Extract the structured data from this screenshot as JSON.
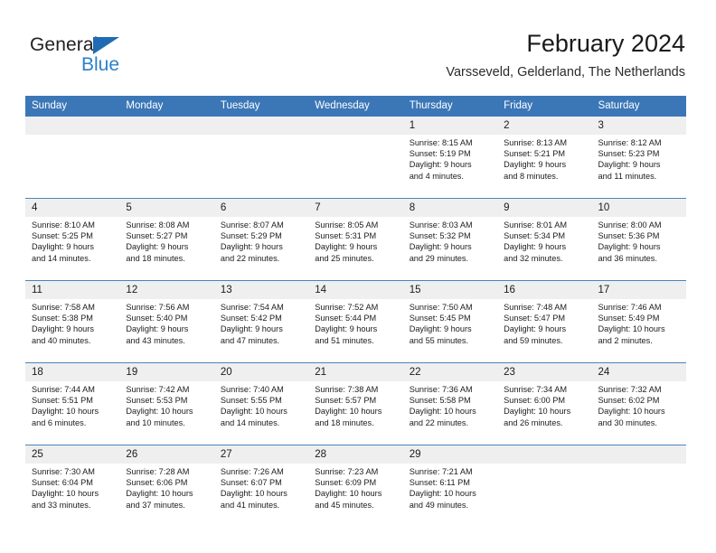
{
  "brand": {
    "name_part1": "General",
    "name_part2": "Blue",
    "triangle_color": "#1f6cb4",
    "blue_color": "#2a81c8"
  },
  "header": {
    "title": "February 2024",
    "subtitle": "Varsseveld, Gelderland, The Netherlands"
  },
  "theme": {
    "header_blue": "#3b77b7",
    "row_divider": "#4a84be",
    "daynum_band": "#efefef"
  },
  "weekday_headers": [
    "Sunday",
    "Monday",
    "Tuesday",
    "Wednesday",
    "Thursday",
    "Friday",
    "Saturday"
  ],
  "weeks": [
    [
      {
        "day": "",
        "lines": []
      },
      {
        "day": "",
        "lines": []
      },
      {
        "day": "",
        "lines": []
      },
      {
        "day": "",
        "lines": []
      },
      {
        "day": "1",
        "lines": [
          "Sunrise: 8:15 AM",
          "Sunset: 5:19 PM",
          "Daylight: 9 hours",
          "and 4 minutes."
        ]
      },
      {
        "day": "2",
        "lines": [
          "Sunrise: 8:13 AM",
          "Sunset: 5:21 PM",
          "Daylight: 9 hours",
          "and 8 minutes."
        ]
      },
      {
        "day": "3",
        "lines": [
          "Sunrise: 8:12 AM",
          "Sunset: 5:23 PM",
          "Daylight: 9 hours",
          "and 11 minutes."
        ]
      }
    ],
    [
      {
        "day": "4",
        "lines": [
          "Sunrise: 8:10 AM",
          "Sunset: 5:25 PM",
          "Daylight: 9 hours",
          "and 14 minutes."
        ]
      },
      {
        "day": "5",
        "lines": [
          "Sunrise: 8:08 AM",
          "Sunset: 5:27 PM",
          "Daylight: 9 hours",
          "and 18 minutes."
        ]
      },
      {
        "day": "6",
        "lines": [
          "Sunrise: 8:07 AM",
          "Sunset: 5:29 PM",
          "Daylight: 9 hours",
          "and 22 minutes."
        ]
      },
      {
        "day": "7",
        "lines": [
          "Sunrise: 8:05 AM",
          "Sunset: 5:31 PM",
          "Daylight: 9 hours",
          "and 25 minutes."
        ]
      },
      {
        "day": "8",
        "lines": [
          "Sunrise: 8:03 AM",
          "Sunset: 5:32 PM",
          "Daylight: 9 hours",
          "and 29 minutes."
        ]
      },
      {
        "day": "9",
        "lines": [
          "Sunrise: 8:01 AM",
          "Sunset: 5:34 PM",
          "Daylight: 9 hours",
          "and 32 minutes."
        ]
      },
      {
        "day": "10",
        "lines": [
          "Sunrise: 8:00 AM",
          "Sunset: 5:36 PM",
          "Daylight: 9 hours",
          "and 36 minutes."
        ]
      }
    ],
    [
      {
        "day": "11",
        "lines": [
          "Sunrise: 7:58 AM",
          "Sunset: 5:38 PM",
          "Daylight: 9 hours",
          "and 40 minutes."
        ]
      },
      {
        "day": "12",
        "lines": [
          "Sunrise: 7:56 AM",
          "Sunset: 5:40 PM",
          "Daylight: 9 hours",
          "and 43 minutes."
        ]
      },
      {
        "day": "13",
        "lines": [
          "Sunrise: 7:54 AM",
          "Sunset: 5:42 PM",
          "Daylight: 9 hours",
          "and 47 minutes."
        ]
      },
      {
        "day": "14",
        "lines": [
          "Sunrise: 7:52 AM",
          "Sunset: 5:44 PM",
          "Daylight: 9 hours",
          "and 51 minutes."
        ]
      },
      {
        "day": "15",
        "lines": [
          "Sunrise: 7:50 AM",
          "Sunset: 5:45 PM",
          "Daylight: 9 hours",
          "and 55 minutes."
        ]
      },
      {
        "day": "16",
        "lines": [
          "Sunrise: 7:48 AM",
          "Sunset: 5:47 PM",
          "Daylight: 9 hours",
          "and 59 minutes."
        ]
      },
      {
        "day": "17",
        "lines": [
          "Sunrise: 7:46 AM",
          "Sunset: 5:49 PM",
          "Daylight: 10 hours",
          "and 2 minutes."
        ]
      }
    ],
    [
      {
        "day": "18",
        "lines": [
          "Sunrise: 7:44 AM",
          "Sunset: 5:51 PM",
          "Daylight: 10 hours",
          "and 6 minutes."
        ]
      },
      {
        "day": "19",
        "lines": [
          "Sunrise: 7:42 AM",
          "Sunset: 5:53 PM",
          "Daylight: 10 hours",
          "and 10 minutes."
        ]
      },
      {
        "day": "20",
        "lines": [
          "Sunrise: 7:40 AM",
          "Sunset: 5:55 PM",
          "Daylight: 10 hours",
          "and 14 minutes."
        ]
      },
      {
        "day": "21",
        "lines": [
          "Sunrise: 7:38 AM",
          "Sunset: 5:57 PM",
          "Daylight: 10 hours",
          "and 18 minutes."
        ]
      },
      {
        "day": "22",
        "lines": [
          "Sunrise: 7:36 AM",
          "Sunset: 5:58 PM",
          "Daylight: 10 hours",
          "and 22 minutes."
        ]
      },
      {
        "day": "23",
        "lines": [
          "Sunrise: 7:34 AM",
          "Sunset: 6:00 PM",
          "Daylight: 10 hours",
          "and 26 minutes."
        ]
      },
      {
        "day": "24",
        "lines": [
          "Sunrise: 7:32 AM",
          "Sunset: 6:02 PM",
          "Daylight: 10 hours",
          "and 30 minutes."
        ]
      }
    ],
    [
      {
        "day": "25",
        "lines": [
          "Sunrise: 7:30 AM",
          "Sunset: 6:04 PM",
          "Daylight: 10 hours",
          "and 33 minutes."
        ]
      },
      {
        "day": "26",
        "lines": [
          "Sunrise: 7:28 AM",
          "Sunset: 6:06 PM",
          "Daylight: 10 hours",
          "and 37 minutes."
        ]
      },
      {
        "day": "27",
        "lines": [
          "Sunrise: 7:26 AM",
          "Sunset: 6:07 PM",
          "Daylight: 10 hours",
          "and 41 minutes."
        ]
      },
      {
        "day": "28",
        "lines": [
          "Sunrise: 7:23 AM",
          "Sunset: 6:09 PM",
          "Daylight: 10 hours",
          "and 45 minutes."
        ]
      },
      {
        "day": "29",
        "lines": [
          "Sunrise: 7:21 AM",
          "Sunset: 6:11 PM",
          "Daylight: 10 hours",
          "and 49 minutes."
        ]
      },
      {
        "day": "",
        "lines": []
      },
      {
        "day": "",
        "lines": []
      }
    ]
  ]
}
